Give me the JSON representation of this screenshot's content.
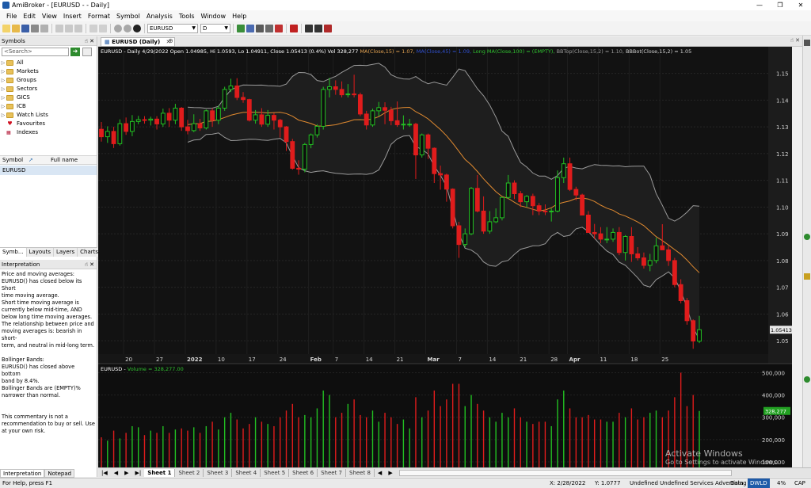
{
  "window": {
    "title": "AmiBroker - [EURUSD - - Daily]"
  },
  "menu": [
    "File",
    "Edit",
    "View",
    "Insert",
    "Format",
    "Symbol",
    "Analysis",
    "Tools",
    "Window",
    "Help"
  ],
  "toolbar": {
    "symbol_value": "EURUSD",
    "interval_value": "D"
  },
  "left_panel": {
    "symbols_title": "Symbols",
    "search_placeholder": "<Search>",
    "tree": [
      {
        "label": "All",
        "icon": "folder"
      },
      {
        "label": "Markets",
        "icon": "folder"
      },
      {
        "label": "Groups",
        "icon": "folder"
      },
      {
        "label": "Sectors",
        "icon": "folder"
      },
      {
        "label": "GICS",
        "icon": "folder"
      },
      {
        "label": "ICB",
        "icon": "folder"
      },
      {
        "label": "Watch Lists",
        "icon": "folder"
      },
      {
        "label": "Favourites",
        "icon": "heart"
      },
      {
        "label": "Indexes",
        "icon": "index"
      }
    ],
    "symbol_header": "Symbol",
    "fullname_header": "Full name",
    "symbol_row": "EURUSD",
    "tabs": [
      "Symb...",
      "Layouts",
      "Layers",
      "Charts"
    ],
    "interpretation_title": "Interpretation",
    "interpretation_lines": [
      "Price and moving averages:",
      "EURUSD() has closed below its Short",
      "time moving average.",
      "Short time moving average is",
      "currently below mid-time, AND",
      "below long time moving averages.",
      "The relationship between price and",
      "moving averages is: bearish in short-",
      "term, and neutral in mid-long term.",
      "",
      "Bollinger Bands:",
      "EURUSD() has closed above bottom",
      "band by 8.4%.",
      "Bollinger Bands are (EMPTY)%",
      "narrower than normal.",
      "",
      "",
      "This commentary is not a",
      "recommendation to buy or sell. Use",
      "at your own risk."
    ],
    "bottom_tabs": [
      "Interpretation",
      "Notepad"
    ]
  },
  "doc_tab": "EURUSD (Daily)",
  "price_pane": {
    "header_parts": [
      {
        "text": "EURUSD - Daily 4/29/2022 Open 1.04985, Hi 1.0593, Lo 1.04911, Close 1.05413 (0.4%) Vol 328,277 ",
        "color": "#ffffff"
      },
      {
        "text": "MA(Close,15) = 1.07,",
        "color": "#e0a050"
      },
      {
        "text": " MA(Close,45) = 1.09,",
        "color": "#3050d0"
      },
      {
        "text": " Long MA(Close,100) = (EMPTY),",
        "color": "#30c030"
      },
      {
        "text": " BBTop(Close,15,2) = 1.10,",
        "color": "#9a9a9a"
      },
      {
        "text": " BBBot(Close,15,2) = 1.05",
        "color": "#d0d0d0"
      }
    ],
    "price_labels": [
      "1.15",
      "1.14",
      "1.13",
      "1.12",
      "1.11",
      "1.10",
      "1.09",
      "1.08",
      "1.07",
      "1.06",
      "1.05"
    ],
    "last_price_label": "1.05413",
    "date_labels": [
      "20",
      "27",
      "2022",
      "10",
      "17",
      "24",
      "Feb",
      "7",
      "14",
      "21",
      "Mar",
      "7",
      "14",
      "21",
      "28",
      "Apr",
      "11",
      "18",
      "25"
    ]
  },
  "volume_pane": {
    "header_prefix": "EURUSD - ",
    "header_volume": "Volume = 328,277.00",
    "vol_labels": [
      "500,000",
      "400,000",
      "300,000",
      "200,000",
      "100,000"
    ],
    "last_volume_label": "328,277"
  },
  "sheet_tabs": [
    "Sheet 1",
    "Sheet 2",
    "Sheet 3",
    "Sheet 4",
    "Sheet 5",
    "Sheet 6",
    "Sheet 7",
    "Sheet 8"
  ],
  "status": {
    "help": "For Help, press F1",
    "x": "X: 2/28/2022",
    "y": "Y: 1.0777",
    "items": "Undefined  Undefined  Services  Advertising",
    "data": "Data",
    "dwld": "DWLD",
    "pct": "4%",
    "cap": "CAP"
  },
  "watermark": {
    "title": "Activate Windows",
    "sub": "Go to Settings to activate Windows."
  },
  "colors": {
    "up": "#22c022",
    "down": "#e01c1c",
    "ma15": "#e08a30",
    "bb": "#9a9a9a",
    "bg": "#121212"
  },
  "chart_data": {
    "type": "candlestick",
    "ylim": [
      1.045,
      1.157
    ],
    "bars": [
      {
        "date": "12/15",
        "o": 1.1291,
        "h": 1.1318,
        "l": 1.1245,
        "c": 1.1263
      },
      {
        "date": "12/16",
        "o": 1.1263,
        "h": 1.1302,
        "l": 1.124,
        "c": 1.1283
      },
      {
        "date": "12/17",
        "o": 1.1283,
        "h": 1.13,
        "l": 1.1221,
        "c": 1.1237
      },
      {
        "date": "12/20",
        "o": 1.1237,
        "h": 1.1328,
        "l": 1.123,
        "c": 1.1312
      },
      {
        "date": "12/21",
        "o": 1.1312,
        "h": 1.1335,
        "l": 1.127,
        "c": 1.1283
      },
      {
        "date": "12/22",
        "o": 1.1283,
        "h": 1.1344,
        "l": 1.1265,
        "c": 1.132
      },
      {
        "date": "12/23",
        "o": 1.132,
        "h": 1.1341,
        "l": 1.131,
        "c": 1.1327
      },
      {
        "date": "12/24",
        "o": 1.1327,
        "h": 1.134,
        "l": 1.1312,
        "c": 1.1325
      },
      {
        "date": "12/27",
        "o": 1.1325,
        "h": 1.1338,
        "l": 1.1305,
        "c": 1.1329
      },
      {
        "date": "12/28",
        "o": 1.1329,
        "h": 1.134,
        "l": 1.129,
        "c": 1.1311
      },
      {
        "date": "12/29",
        "o": 1.1311,
        "h": 1.1368,
        "l": 1.13,
        "c": 1.1351
      },
      {
        "date": "12/30",
        "o": 1.1351,
        "h": 1.137,
        "l": 1.13,
        "c": 1.1325
      },
      {
        "date": "12/31",
        "o": 1.1325,
        "h": 1.1386,
        "l": 1.131,
        "c": 1.137
      },
      {
        "date": "1/03",
        "o": 1.137,
        "h": 1.1374,
        "l": 1.1285,
        "c": 1.13
      },
      {
        "date": "1/04",
        "o": 1.13,
        "h": 1.1326,
        "l": 1.1272,
        "c": 1.1286
      },
      {
        "date": "1/05",
        "o": 1.1286,
        "h": 1.1347,
        "l": 1.128,
        "c": 1.1312
      },
      {
        "date": "1/06",
        "o": 1.1312,
        "h": 1.133,
        "l": 1.1285,
        "c": 1.1296
      },
      {
        "date": "1/07",
        "o": 1.1296,
        "h": 1.1365,
        "l": 1.129,
        "c": 1.136
      },
      {
        "date": "1/10",
        "o": 1.136,
        "h": 1.137,
        "l": 1.13,
        "c": 1.1325
      },
      {
        "date": "1/11",
        "o": 1.1325,
        "h": 1.138,
        "l": 1.131,
        "c": 1.137
      },
      {
        "date": "1/12",
        "o": 1.137,
        "h": 1.145,
        "l": 1.136,
        "c": 1.144
      },
      {
        "date": "1/13",
        "o": 1.144,
        "h": 1.148,
        "l": 1.143,
        "c": 1.1453
      },
      {
        "date": "1/14",
        "o": 1.1453,
        "h": 1.1482,
        "l": 1.14,
        "c": 1.141
      },
      {
        "date": "1/17",
        "o": 1.141,
        "h": 1.143,
        "l": 1.139,
        "c": 1.1402
      },
      {
        "date": "1/18",
        "o": 1.1402,
        "h": 1.1405,
        "l": 1.132,
        "c": 1.1325
      },
      {
        "date": "1/19",
        "o": 1.1325,
        "h": 1.1363,
        "l": 1.1312,
        "c": 1.1345
      },
      {
        "date": "1/20",
        "o": 1.1345,
        "h": 1.137,
        "l": 1.13,
        "c": 1.131
      },
      {
        "date": "1/21",
        "o": 1.131,
        "h": 1.1363,
        "l": 1.13,
        "c": 1.1343
      },
      {
        "date": "1/24",
        "o": 1.1343,
        "h": 1.1352,
        "l": 1.129,
        "c": 1.1325
      },
      {
        "date": "1/25",
        "o": 1.1325,
        "h": 1.133,
        "l": 1.126,
        "c": 1.13
      },
      {
        "date": "1/26",
        "o": 1.13,
        "h": 1.1303,
        "l": 1.121,
        "c": 1.1245
      },
      {
        "date": "1/27",
        "o": 1.1245,
        "h": 1.1255,
        "l": 1.114,
        "c": 1.1145
      },
      {
        "date": "1/28",
        "o": 1.1145,
        "h": 1.1175,
        "l": 1.1121,
        "c": 1.1142
      },
      {
        "date": "1/31",
        "o": 1.1142,
        "h": 1.124,
        "l": 1.113,
        "c": 1.1234
      },
      {
        "date": "2/01",
        "o": 1.1234,
        "h": 1.1275,
        "l": 1.122,
        "c": 1.127
      },
      {
        "date": "2/02",
        "o": 1.127,
        "h": 1.131,
        "l": 1.126,
        "c": 1.1302
      },
      {
        "date": "2/03",
        "o": 1.1302,
        "h": 1.145,
        "l": 1.129,
        "c": 1.144
      },
      {
        "date": "2/04",
        "o": 1.144,
        "h": 1.1483,
        "l": 1.141,
        "c": 1.145
      },
      {
        "date": "2/07",
        "o": 1.145,
        "h": 1.1474,
        "l": 1.142,
        "c": 1.144
      },
      {
        "date": "2/08",
        "o": 1.144,
        "h": 1.147,
        "l": 1.141,
        "c": 1.142
      },
      {
        "date": "2/09",
        "o": 1.142,
        "h": 1.146,
        "l": 1.141,
        "c": 1.1423
      },
      {
        "date": "2/10",
        "o": 1.1423,
        "h": 1.1495,
        "l": 1.141,
        "c": 1.142
      },
      {
        "date": "2/11",
        "o": 1.142,
        "h": 1.1428,
        "l": 1.134,
        "c": 1.1348
      },
      {
        "date": "2/14",
        "o": 1.1348,
        "h": 1.136,
        "l": 1.129,
        "c": 1.1307
      },
      {
        "date": "2/15",
        "o": 1.1307,
        "h": 1.1368,
        "l": 1.13,
        "c": 1.136
      },
      {
        "date": "2/16",
        "o": 1.136,
        "h": 1.1393,
        "l": 1.134,
        "c": 1.1372
      },
      {
        "date": "2/17",
        "o": 1.1372,
        "h": 1.1392,
        "l": 1.131,
        "c": 1.1362
      },
      {
        "date": "2/18",
        "o": 1.1362,
        "h": 1.1375,
        "l": 1.1306,
        "c": 1.1323
      },
      {
        "date": "2/21",
        "o": 1.1323,
        "h": 1.1395,
        "l": 1.13,
        "c": 1.1308
      },
      {
        "date": "2/22",
        "o": 1.1308,
        "h": 1.1343,
        "l": 1.129,
        "c": 1.131
      },
      {
        "date": "2/23",
        "o": 1.131,
        "h": 1.133,
        "l": 1.13,
        "c": 1.131
      },
      {
        "date": "2/24",
        "o": 1.131,
        "h": 1.1315,
        "l": 1.1105,
        "c": 1.1195
      },
      {
        "date": "2/25",
        "o": 1.1195,
        "h": 1.1275,
        "l": 1.1185,
        "c": 1.127
      },
      {
        "date": "2/28",
        "o": 1.127,
        "h": 1.1275,
        "l": 1.118,
        "c": 1.122
      },
      {
        "date": "3/01",
        "o": 1.122,
        "h": 1.1223,
        "l": 1.109,
        "c": 1.1125
      },
      {
        "date": "3/02",
        "o": 1.1125,
        "h": 1.1155,
        "l": 1.1065,
        "c": 1.112
      },
      {
        "date": "3/03",
        "o": 1.112,
        "h": 1.1125,
        "l": 1.102,
        "c": 1.1067
      },
      {
        "date": "3/04",
        "o": 1.1067,
        "h": 1.107,
        "l": 1.092,
        "c": 1.093
      },
      {
        "date": "3/07",
        "o": 1.093,
        "h": 1.0945,
        "l": 1.081,
        "c": 1.086
      },
      {
        "date": "3/08",
        "o": 1.086,
        "h": 1.092,
        "l": 1.085,
        "c": 1.09
      },
      {
        "date": "3/09",
        "o": 1.09,
        "h": 1.1075,
        "l": 1.0895,
        "c": 1.107
      },
      {
        "date": "3/10",
        "o": 1.107,
        "h": 1.112,
        "l": 1.098,
        "c": 1.0985
      },
      {
        "date": "3/11",
        "o": 1.0985,
        "h": 1.104,
        "l": 1.09,
        "c": 1.091
      },
      {
        "date": "3/14",
        "o": 1.091,
        "h": 1.0985,
        "l": 1.09,
        "c": 1.0945
      },
      {
        "date": "3/15",
        "o": 1.0945,
        "h": 1.0995,
        "l": 1.094,
        "c": 1.096
      },
      {
        "date": "3/16",
        "o": 1.096,
        "h": 1.102,
        "l": 1.095,
        "c": 1.1036
      },
      {
        "date": "3/17",
        "o": 1.1036,
        "h": 1.112,
        "l": 1.103,
        "c": 1.109
      },
      {
        "date": "3/18",
        "o": 1.109,
        "h": 1.11,
        "l": 1.103,
        "c": 1.105
      },
      {
        "date": "3/21",
        "o": 1.105,
        "h": 1.106,
        "l": 1.1,
        "c": 1.102
      },
      {
        "date": "3/22",
        "o": 1.102,
        "h": 1.1045,
        "l": 1.1,
        "c": 1.104
      },
      {
        "date": "3/23",
        "o": 1.104,
        "h": 1.105,
        "l": 1.097,
        "c": 1.1005
      },
      {
        "date": "3/24",
        "o": 1.1005,
        "h": 1.1015,
        "l": 1.097,
        "c": 1.0985
      },
      {
        "date": "3/25",
        "o": 1.0985,
        "h": 1.101,
        "l": 1.097,
        "c": 1.0983
      },
      {
        "date": "3/28",
        "o": 1.0983,
        "h": 1.0995,
        "l": 1.0946,
        "c": 1.0985
      },
      {
        "date": "3/29",
        "o": 1.0985,
        "h": 1.1137,
        "l": 1.098,
        "c": 1.111
      },
      {
        "date": "3/30",
        "o": 1.111,
        "h": 1.1185,
        "l": 1.109,
        "c": 1.1162
      },
      {
        "date": "3/31",
        "o": 1.1162,
        "h": 1.1185,
        "l": 1.106,
        "c": 1.1066
      },
      {
        "date": "4/01",
        "o": 1.1066,
        "h": 1.1076,
        "l": 1.1025,
        "c": 1.1045
      },
      {
        "date": "4/04",
        "o": 1.1045,
        "h": 1.105,
        "l": 1.097,
        "c": 1.097
      },
      {
        "date": "4/05",
        "o": 1.097,
        "h": 1.0985,
        "l": 1.0905,
        "c": 1.0905
      },
      {
        "date": "4/06",
        "o": 1.0905,
        "h": 1.0937,
        "l": 1.088,
        "c": 1.09
      },
      {
        "date": "4/07",
        "o": 1.09,
        "h": 1.0925,
        "l": 1.0865,
        "c": 1.088
      },
      {
        "date": "4/08",
        "o": 1.088,
        "h": 1.0925,
        "l": 1.0865,
        "c": 1.088
      },
      {
        "date": "4/11",
        "o": 1.088,
        "h": 1.092,
        "l": 1.087,
        "c": 1.0905
      },
      {
        "date": "4/12",
        "o": 1.0905,
        "h": 1.0925,
        "l": 1.082,
        "c": 1.083
      },
      {
        "date": "4/13",
        "o": 1.083,
        "h": 1.0895,
        "l": 1.08,
        "c": 1.089
      },
      {
        "date": "4/14",
        "o": 1.089,
        "h": 1.0925,
        "l": 1.0795,
        "c": 1.0825
      },
      {
        "date": "4/15",
        "o": 1.0825,
        "h": 1.085,
        "l": 1.08,
        "c": 1.081
      },
      {
        "date": "4/18",
        "o": 1.081,
        "h": 1.083,
        "l": 1.077,
        "c": 1.0782
      },
      {
        "date": "4/19",
        "o": 1.0782,
        "h": 1.0825,
        "l": 1.076,
        "c": 1.08
      },
      {
        "date": "4/20",
        "o": 1.08,
        "h": 1.0885,
        "l": 1.079,
        "c": 1.0855
      },
      {
        "date": "4/21",
        "o": 1.0855,
        "h": 1.0936,
        "l": 1.084,
        "c": 1.084
      },
      {
        "date": "4/22",
        "o": 1.084,
        "h": 1.0855,
        "l": 1.078,
        "c": 1.08
      },
      {
        "date": "4/25",
        "o": 1.08,
        "h": 1.081,
        "l": 1.07,
        "c": 1.071
      },
      {
        "date": "4/26",
        "o": 1.071,
        "h": 1.073,
        "l": 1.064,
        "c": 1.065
      },
      {
        "date": "4/27",
        "o": 1.065,
        "h": 1.066,
        "l": 1.056,
        "c": 1.0575
      },
      {
        "date": "4/28",
        "o": 1.0575,
        "h": 1.058,
        "l": 1.047,
        "c": 1.0499
      },
      {
        "date": "4/29",
        "o": 1.04985,
        "h": 1.0593,
        "l": 1.04911,
        "c": 1.05413
      }
    ],
    "volume_ylim": [
      75000,
      530000
    ],
    "volumes": [
      210000,
      195000,
      240000,
      205000,
      230000,
      260000,
      255000,
      220000,
      240000,
      230000,
      260000,
      230000,
      245000,
      250000,
      240000,
      255000,
      230000,
      260000,
      280000,
      245000,
      300000,
      320000,
      290000,
      250000,
      270000,
      300000,
      280000,
      270000,
      260000,
      300000,
      330000,
      360000,
      300000,
      310000,
      300000,
      340000,
      420000,
      400000,
      300000,
      320000,
      360000,
      380000,
      310000,
      300000,
      330000,
      280000,
      320000,
      300000,
      270000,
      290000,
      250000,
      390000,
      300000,
      330000,
      420000,
      350000,
      380000,
      450000,
      450000,
      350000,
      400000,
      360000,
      330000,
      300000,
      280000,
      320000,
      300000,
      340000,
      300000,
      280000,
      270000,
      280000,
      280000,
      260000,
      380000,
      420000,
      340000,
      300000,
      300000,
      310000,
      290000,
      290000,
      280000,
      280000,
      320000,
      300000,
      340000,
      290000,
      300000,
      320000,
      330000,
      300000,
      330000,
      390000,
      500000,
      350000,
      400000,
      328277
    ]
  }
}
